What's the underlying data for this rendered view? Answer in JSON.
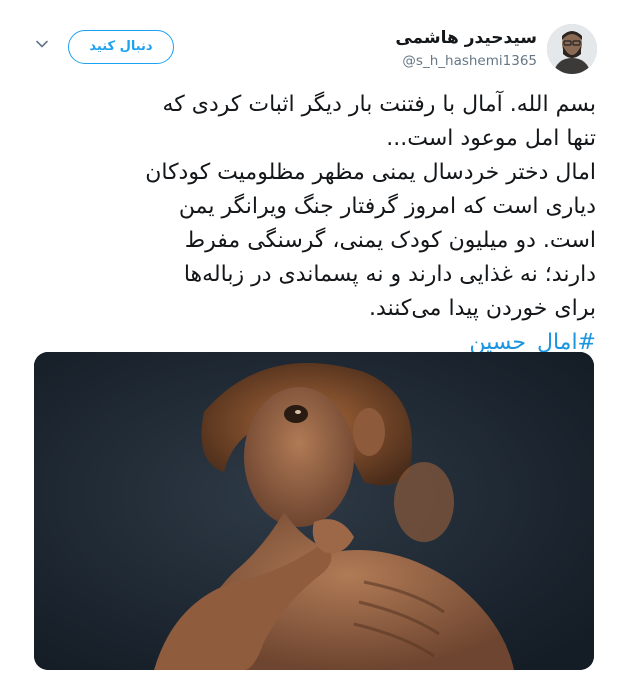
{
  "user": {
    "display_name": "سیدحیدر هاشمی",
    "handle": "@s_h_hashemi1365",
    "avatar_icon": "user-avatar"
  },
  "follow_button": {
    "label": "دنبال کنید"
  },
  "menu": {
    "icon": "chevron-down-icon"
  },
  "tweet": {
    "lines": [
      "بسم الله. آمال با رفتنت بار دیگر اثبات کردی که",
      "تنها امل موعود است...",
      "امال دختر خردسال یمنی مظهر مظلومیت کودکان",
      "دیاری است که امروز گرفتار جنگ ویرانگر یمن",
      "است. دو میلیون کودک یمنی، گرسنگی مفرط",
      "دارند؛ نه غذایی دارند و نه پسماندی در زباله‌ها",
      "برای خوردن پیدا می‌کنند."
    ],
    "hashtag": "#امال_حسین"
  },
  "colors": {
    "accent": "#1da1f2",
    "hashtag": "#1b95e0",
    "text": "#14171a",
    "muted": "#657786"
  }
}
